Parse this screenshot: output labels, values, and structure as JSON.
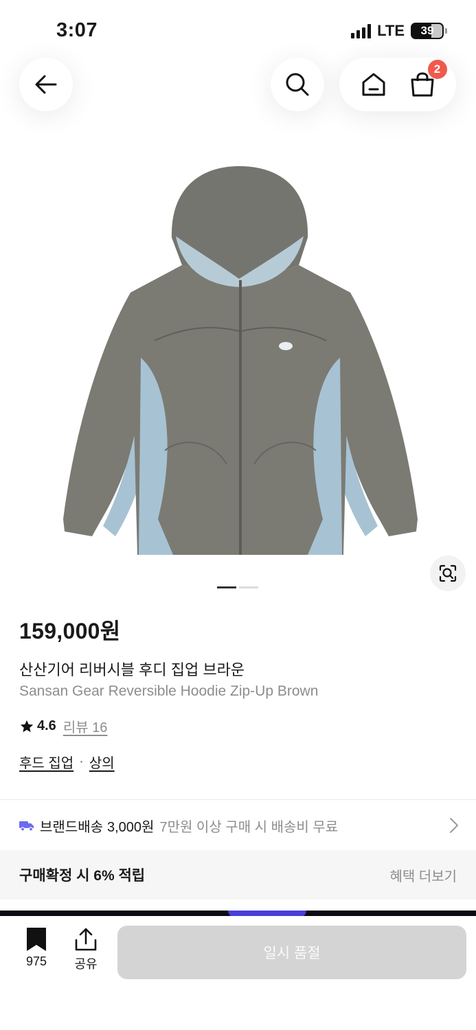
{
  "status_bar": {
    "time": "3:07",
    "network": "LTE",
    "battery": "39"
  },
  "header": {
    "back_icon": "arrow-left-icon",
    "search_icon": "search-icon",
    "home_icon": "home-icon",
    "cart_icon": "shopping-bag-icon",
    "cart_count": "2",
    "badge_color": "#ef5a4d"
  },
  "gallery": {
    "image_subject": "reversible hooded zip-up jacket, brown-grey body with light blue side panels",
    "lens_icon": "image-search-icon",
    "slides_total": 2,
    "slide_active": 1
  },
  "product": {
    "price": "159,000원",
    "name_kr": "산산기어 리버시블 후디 집업 브라운",
    "name_en": "Sansan Gear Reversible Hoodie Zip-Up Brown",
    "rating": "4.6",
    "review_label": "리뷰 16",
    "categories": [
      "후드 집업",
      "상의"
    ],
    "category_separator": "·"
  },
  "shipping": {
    "icon": "truck-icon",
    "icon_color": "#6a6cf0",
    "label": "브랜드배송",
    "fee": "3,000원",
    "note": "7만원 이상 구매 시 배송비 무료"
  },
  "benefit": {
    "text": "구매확정 시 6% 적립",
    "link": "혜택 더보기"
  },
  "bottom_bar": {
    "bookmark_icon": "bookmark-icon",
    "bookmark_count": "975",
    "share_icon": "share-icon",
    "share_label": "공유",
    "cta_label": "일시 품절"
  }
}
